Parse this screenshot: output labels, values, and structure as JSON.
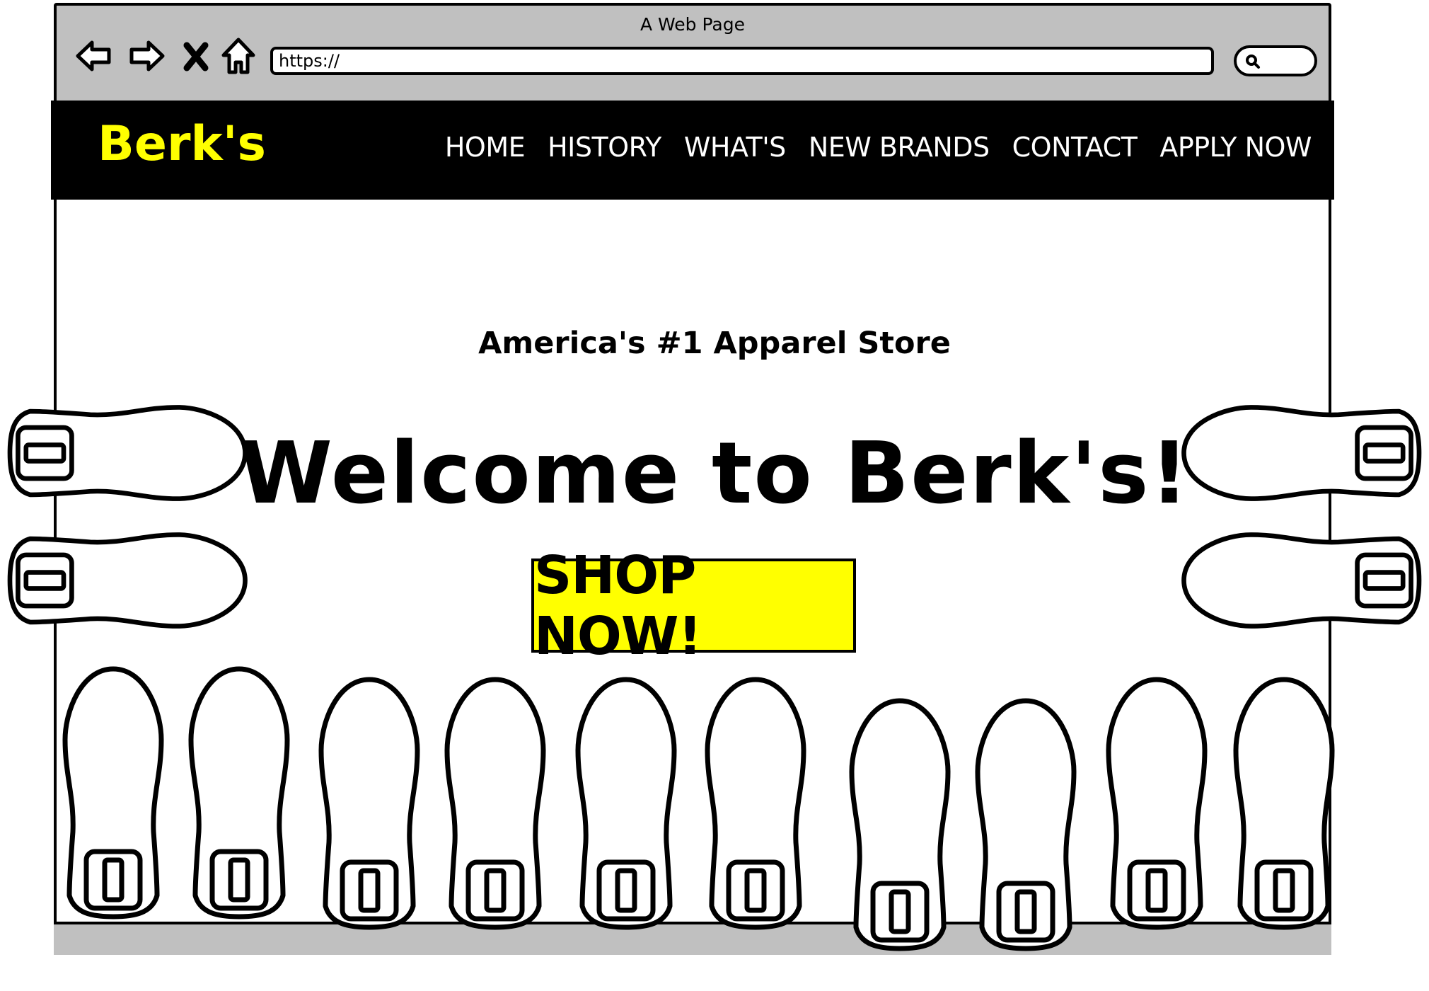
{
  "browser": {
    "window_title": "A Web Page",
    "url": "https://"
  },
  "site": {
    "logo": "Berk's",
    "nav": [
      "HOME",
      "HISTORY",
      "WHAT'S",
      "NEW BRANDS",
      "CONTACT",
      "APPLY NOW"
    ],
    "tagline": "America's #1 Apparel Store",
    "headline": "Welcome to Berk's!",
    "cta_label": "SHOP NOW!"
  },
  "colors": {
    "accent": "#ffff00",
    "header_bg": "#000000",
    "chrome": "#c0c0c0"
  }
}
